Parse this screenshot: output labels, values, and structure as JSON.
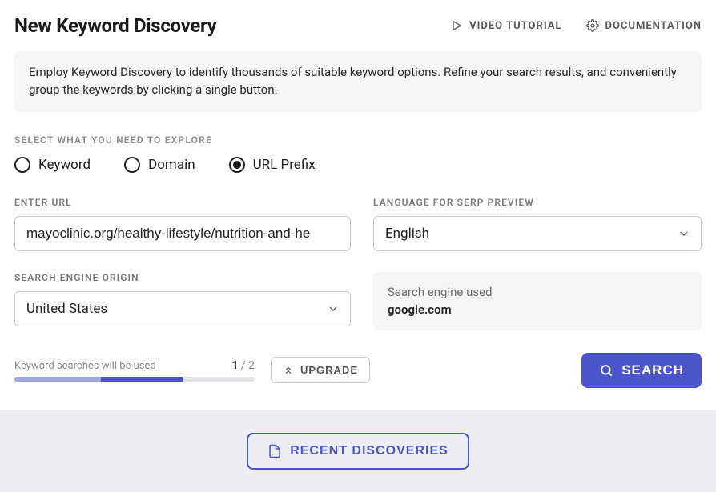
{
  "header": {
    "title": "New Keyword Discovery",
    "video_tutorial": "VIDEO TUTORIAL",
    "documentation": "DOCUMENTATION"
  },
  "info_text": "Employ Keyword Discovery to identify thousands of suitable keyword options. Refine your search results, and conveniently group the keywords by clicking a single button.",
  "explore": {
    "section_label": "SELECT WHAT YOU NEED TO EXPLORE",
    "options": [
      "Keyword",
      "Domain",
      "URL Prefix"
    ],
    "selected_index": 2
  },
  "url_field": {
    "label": "ENTER URL",
    "value": "mayoclinic.org/healthy-lifestyle/nutrition-and-he"
  },
  "language_field": {
    "label": "LANGUAGE FOR SERP PREVIEW",
    "value": "English"
  },
  "origin_field": {
    "label": "SEARCH ENGINE ORIGIN",
    "value": "United States"
  },
  "engine_info": {
    "label": "Search engine used",
    "value": "google.com"
  },
  "usage": {
    "text": "Keyword searches will be used",
    "used": 1,
    "total": 2,
    "light_percent": 36,
    "dark_percent": 34
  },
  "buttons": {
    "upgrade": "UPGRADE",
    "search": "SEARCH",
    "recent": "RECENT DISCOVERIES"
  }
}
